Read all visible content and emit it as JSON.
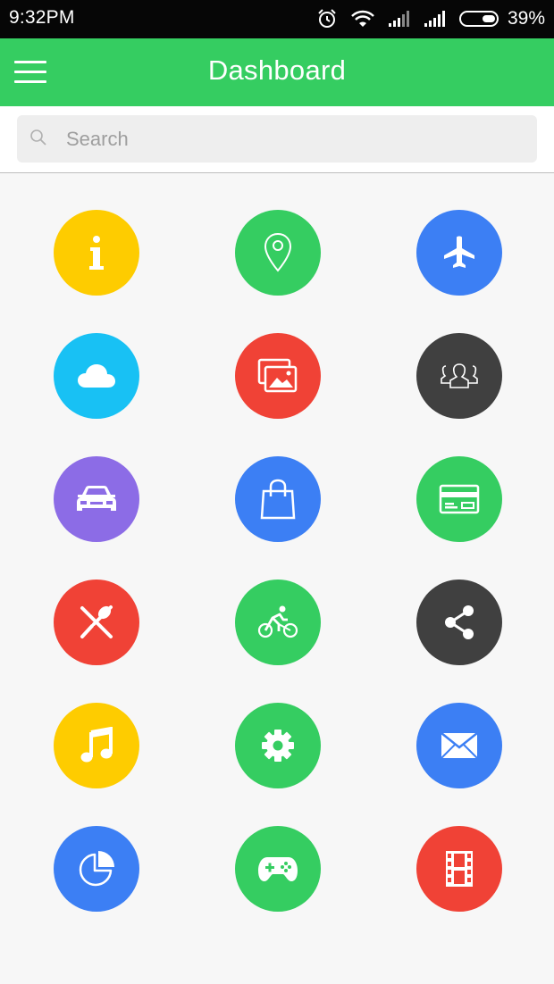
{
  "status_bar": {
    "time": "9:32PM",
    "battery_percent": "39%",
    "icons": [
      "alarm-icon",
      "wifi-icon",
      "signal-icon",
      "signal-icon",
      "battery-icon"
    ]
  },
  "app_bar": {
    "title": "Dashboard",
    "menu_icon": "menu-icon"
  },
  "search": {
    "placeholder": "Search",
    "value": ""
  },
  "colors": {
    "primary": "#35cd61",
    "yellow": "#fecc00",
    "green": "#35cd61",
    "blue": "#3c7ff4",
    "sky": "#18c1f4",
    "red": "#f04236",
    "dark": "#404040",
    "purple": "#8c6ce6"
  },
  "tiles": [
    {
      "icon": "info-icon",
      "color": "#fecc00"
    },
    {
      "icon": "location-pin-icon",
      "color": "#35cd61"
    },
    {
      "icon": "airplane-icon",
      "color": "#3c7ff4"
    },
    {
      "icon": "cloud-icon",
      "color": "#18c1f4"
    },
    {
      "icon": "photos-icon",
      "color": "#f04236"
    },
    {
      "icon": "group-icon",
      "color": "#404040"
    },
    {
      "icon": "car-icon",
      "color": "#8c6ce6"
    },
    {
      "icon": "shopping-bag-icon",
      "color": "#3c7ff4"
    },
    {
      "icon": "credit-card-icon",
      "color": "#35cd61"
    },
    {
      "icon": "restaurant-icon",
      "color": "#f04236"
    },
    {
      "icon": "cycling-icon",
      "color": "#35cd61"
    },
    {
      "icon": "share-icon",
      "color": "#404040"
    },
    {
      "icon": "music-icon",
      "color": "#fecc00"
    },
    {
      "icon": "settings-icon",
      "color": "#35cd61"
    },
    {
      "icon": "mail-icon",
      "color": "#3c7ff4"
    },
    {
      "icon": "pie-chart-icon",
      "color": "#3c7ff4"
    },
    {
      "icon": "gamepad-icon",
      "color": "#35cd61"
    },
    {
      "icon": "film-icon",
      "color": "#f04236"
    }
  ]
}
